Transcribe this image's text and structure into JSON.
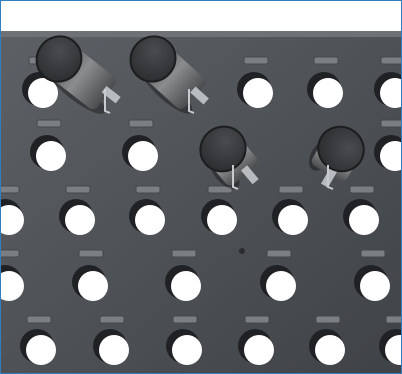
{
  "scene": {
    "subject": "perforated-steel-pegboard-with-cylindrical-tool-holders",
    "colors": {
      "board": "#5d6166",
      "board_shadow": "#3f4246",
      "hole_inner": "#ffffff",
      "hole_shadow": "#1f2124",
      "frame_border": "#2f7fc0",
      "cap_dark": "#2c2d2f",
      "metal": "#8a8c8e"
    },
    "icons": [
      "pegboard-hole-icon",
      "hook-clip-icon",
      "tool-holder-icon"
    ]
  }
}
